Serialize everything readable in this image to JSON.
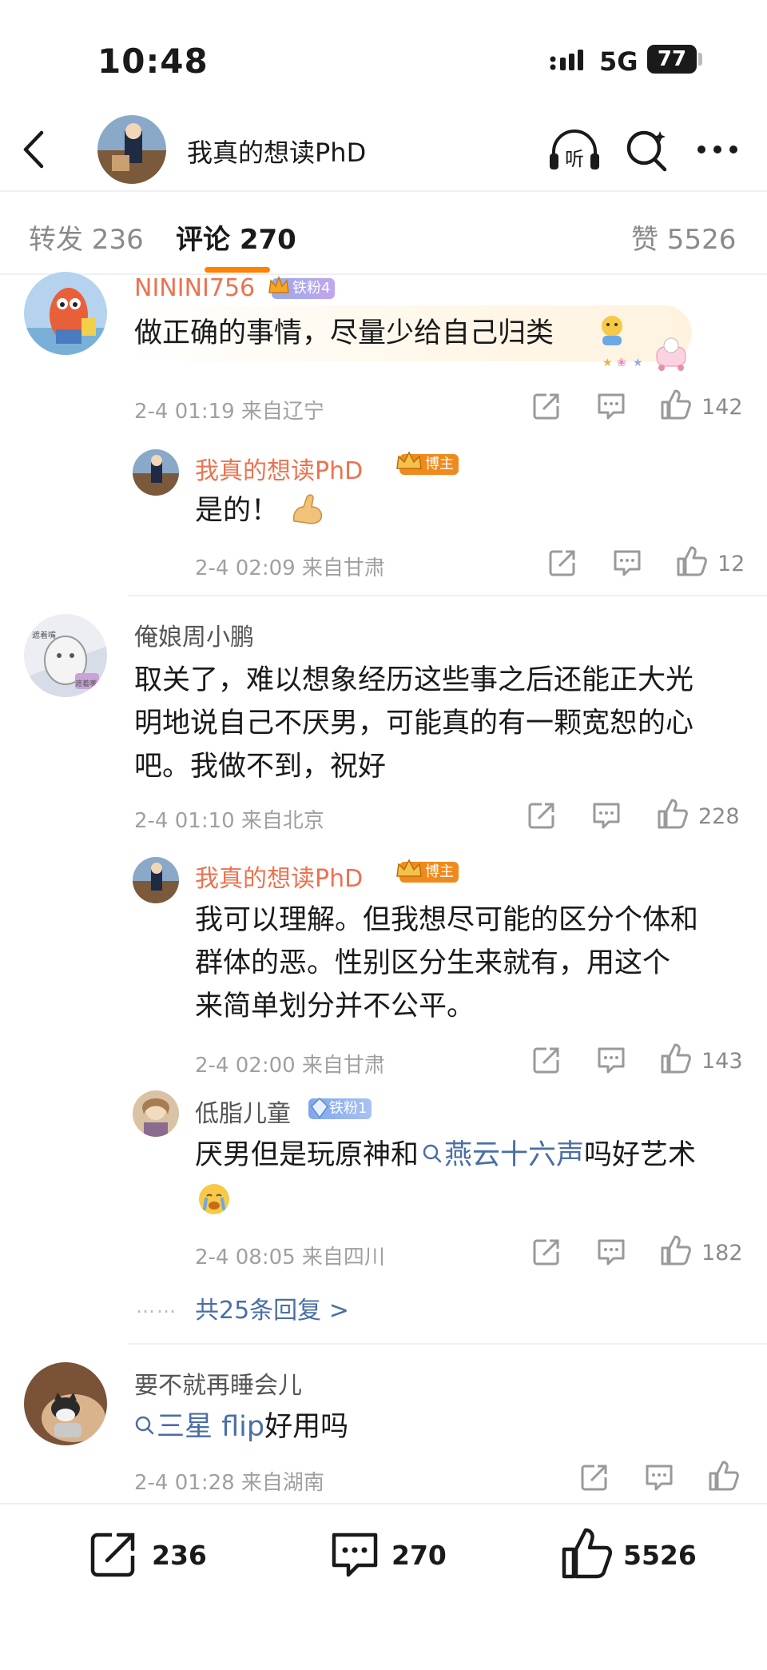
{
  "status_bar": {
    "time": "10:48",
    "network": "5G",
    "battery": "77"
  },
  "header": {
    "title": "我真的想读PhD",
    "listen_label": "听"
  },
  "tabs": {
    "repost": "转发 236",
    "comments": "评论 270",
    "likes": "赞 5526"
  },
  "comments": [
    {
      "user": "NININI756",
      "badge": "铁粉4",
      "text": "做正确的事情，尽量少给自己归类",
      "meta": "2-4 01:19 来自辽宁",
      "likes": "142",
      "replies": [
        {
          "user": "我真的想读PhD",
          "badge": "博主",
          "text": "是的！",
          "meta": "2-4 02:09 来自甘肃",
          "likes": "12"
        }
      ]
    },
    {
      "user": "俺娘周小鹏",
      "text_lines": [
        "取关了，难以想象经历这些事之后还能正大光",
        "明地说自己不厌男，可能真的有一颗宽恕的心",
        "吧。我做不到，祝好"
      ],
      "meta": "2-4 01:10 来自北京",
      "likes": "228",
      "avatar_text": "遮着嘴",
      "replies": [
        {
          "user": "我真的想读PhD",
          "badge": "博主",
          "text_lines": [
            "我可以理解。但我想尽可能的区分个体和",
            "群体的恶。性别区分生来就有，用这个",
            "来简单划分并不公平。"
          ],
          "meta": "2-4 02:00 来自甘肃",
          "likes": "143"
        },
        {
          "user": "低脂儿童",
          "badge": "铁粉1",
          "text_before": "厌男但是玩原神和",
          "topic": "燕云十六声",
          "text_after": "吗好艺术",
          "meta": "2-4 08:05 来自四川",
          "likes": "182"
        }
      ],
      "more_replies": "共25条回复 >",
      "more_dots": "……"
    },
    {
      "user": "要不就再睡会儿",
      "topic": "三星 flip",
      "text_after": "好用吗",
      "meta": "2-4 01:28 来自湖南"
    }
  ],
  "bottom_bar": {
    "repost": "236",
    "comments": "270",
    "likes": "5526"
  },
  "colors": {
    "accent": "#ff8200",
    "username_blogger": "#eb7350",
    "topic_link": "#4a6ea6",
    "meta": "#a0a0a0"
  }
}
